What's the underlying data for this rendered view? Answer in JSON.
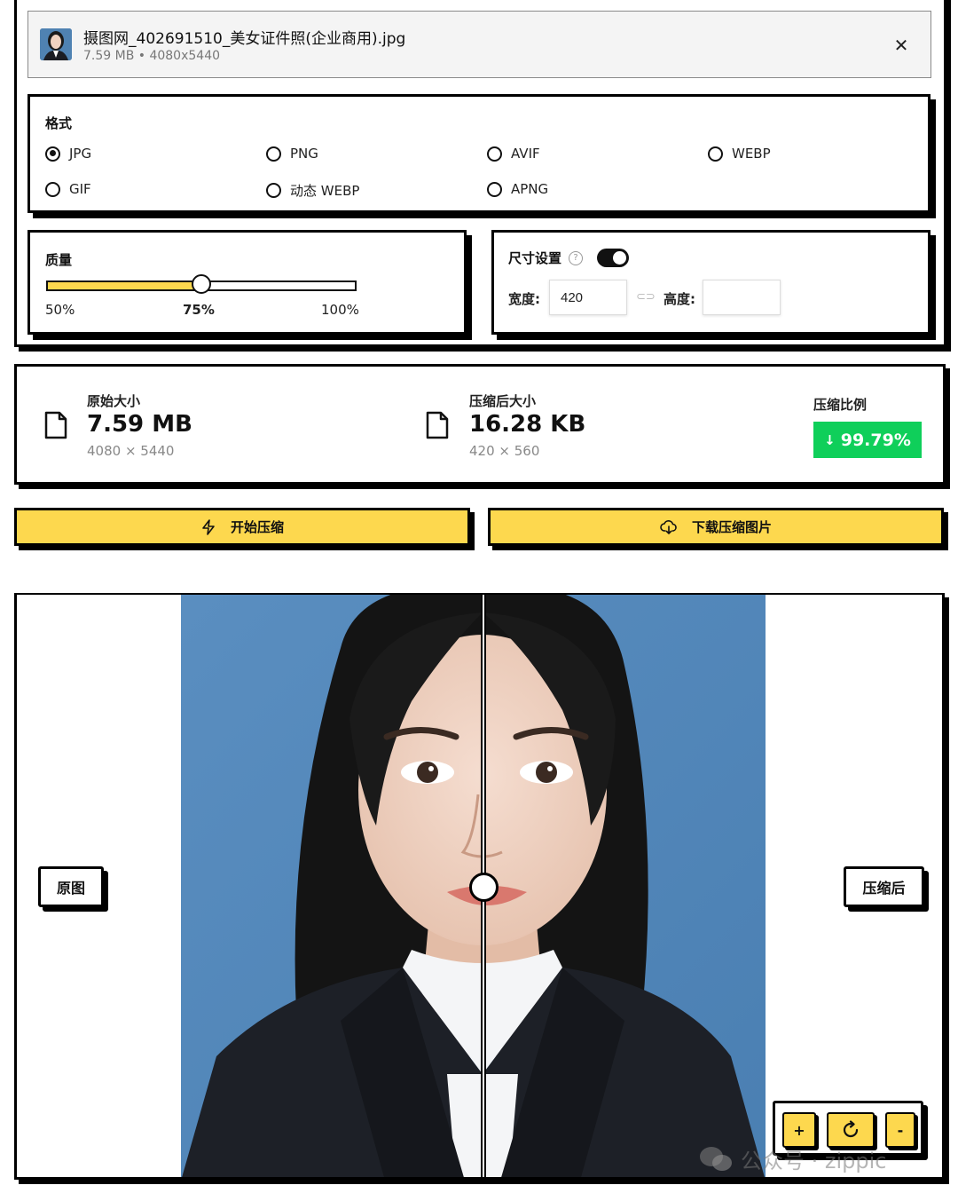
{
  "file": {
    "name": "摄图网_402691510_美女证件照(企业商用).jpg",
    "meta": "7.59 MB • 4080x5440",
    "close_icon": "close-icon"
  },
  "format": {
    "title": "格式",
    "selected": "JPG",
    "options": [
      "JPG",
      "PNG",
      "AVIF",
      "WEBP",
      "GIF",
      "动态 WEBP",
      "APNG"
    ]
  },
  "quality": {
    "title": "质量",
    "value_percent": 75,
    "min_label": "50%",
    "mid_label": "75%",
    "max_label": "100%"
  },
  "size": {
    "title": "尺寸设置",
    "lock_aspect_enabled": true,
    "width_label": "宽度:",
    "width_value": "420",
    "height_label": "高度:",
    "height_value": ""
  },
  "stats": {
    "original": {
      "label": "原始大小",
      "value": "7.59 MB",
      "dims": "4080 × 5440"
    },
    "compressed": {
      "label": "压缩后大小",
      "value": "16.28 KB",
      "dims": "420 × 560"
    },
    "ratio": {
      "label": "压缩比例",
      "value": "99.79%",
      "color": "#0fcf5a"
    }
  },
  "actions": {
    "start_label": "开始压缩",
    "download_label": "下载压缩图片",
    "accent": "#fdd84e"
  },
  "preview": {
    "original_tag": "原图",
    "compressed_tag": "压缩后",
    "zoom_in": "+",
    "zoom_out": "-",
    "divider_position": 0.52
  },
  "watermark": {
    "text": "公众号 · zippic"
  }
}
